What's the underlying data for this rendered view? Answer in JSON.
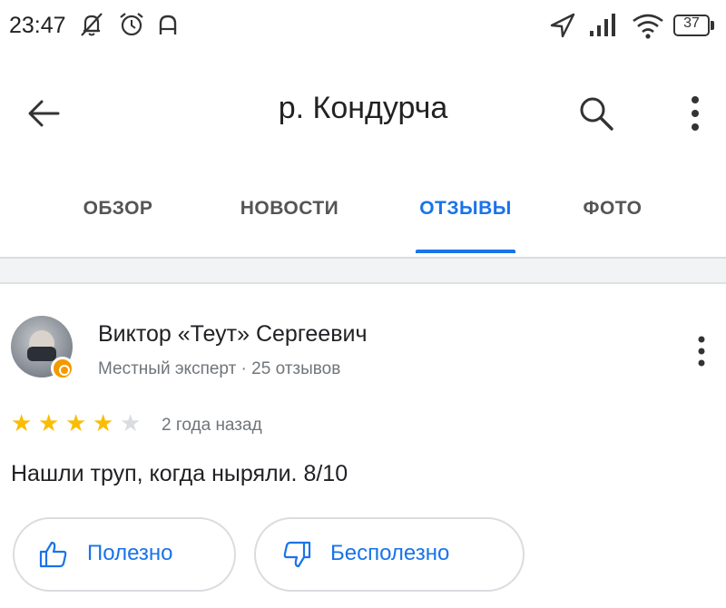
{
  "status_bar": {
    "time": "23:47",
    "icons": [
      "notifications-off-icon",
      "alarm-icon",
      "vpn-key-icon",
      "location-arrow-icon",
      "signal-icon",
      "wifi-icon",
      "battery-icon"
    ],
    "battery": "37"
  },
  "app_bar": {
    "back_icon": "arrow-back-icon",
    "title": "р. Кондурча",
    "search_icon": "search-icon",
    "more_icon": "more-vert-icon"
  },
  "tabs": [
    {
      "label": "ОБЗОР",
      "active": false
    },
    {
      "label": "НОВОСТИ",
      "active": false
    },
    {
      "label": "ОТЗЫВЫ",
      "active": true
    },
    {
      "label": "ФОТО",
      "active": false
    }
  ],
  "review": {
    "author": "Виктор «Теут» Сергеевич",
    "meta": "Местный эксперт · 25 отзывов",
    "rating": 4,
    "max_rating": 5,
    "date": "2 года назад",
    "text": "Нашли труп, когда ныряли. 8/10",
    "helpful_label": "Полезно",
    "unhelpful_label": "Бесполезно"
  },
  "colors": {
    "accent": "#1a73e8",
    "star_filled": "#fbbc04",
    "star_empty": "#dadce0",
    "badge": "#f29900"
  }
}
